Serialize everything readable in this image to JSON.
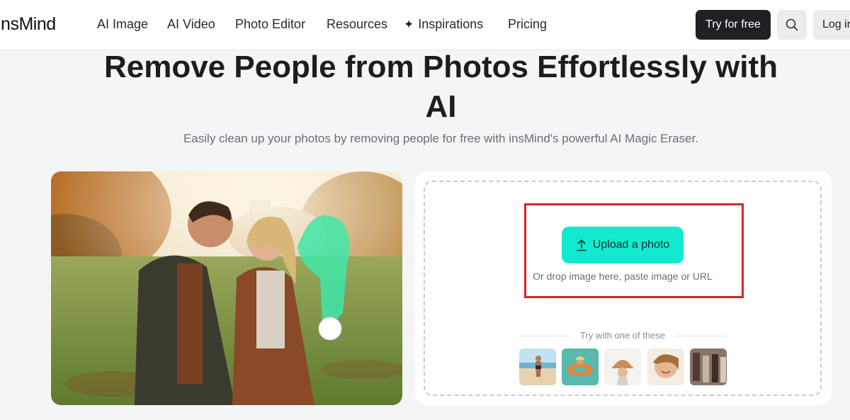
{
  "brand": {
    "logo_text": "insMind"
  },
  "nav": {
    "items": [
      {
        "label": "AI Image"
      },
      {
        "label": "AI Video"
      },
      {
        "label": "Photo Editor"
      },
      {
        "label": "Resources"
      },
      {
        "label": "Inspirations",
        "icon": "sparkle-icon"
      },
      {
        "label": "Pricing"
      }
    ],
    "try_label": "Try for free",
    "search_icon": "search-icon",
    "login_label": "Log in"
  },
  "hero": {
    "title_line1": "Remove People from Photos Effortlessly with",
    "title_line2": "AI",
    "subtitle": "Easily clean up your photos by removing people for free with insMind's powerful AI Magic Eraser."
  },
  "upload": {
    "button_label": "Upload a photo",
    "button_icon": "upload-arrow-icon",
    "drop_hint": "Or drop image here, paste image or URL",
    "try_label": "Try with one of these",
    "samples": [
      "sample-beach-woman",
      "sample-pool-float",
      "sample-bucket-hat",
      "sample-face-smile",
      "sample-street-group"
    ]
  },
  "colors": {
    "accent": "#12ead0",
    "highlight_border": "#d8262e",
    "dark_button": "#1f2023",
    "page_bg": "#f4f5f7"
  }
}
